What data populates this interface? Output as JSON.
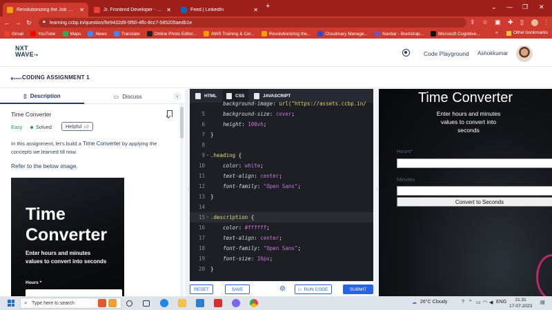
{
  "browser": {
    "tabs": [
      {
        "title": "Revolutionizing the Job Market |",
        "active": true,
        "color": "#f59e0b"
      },
      {
        "title": "Jr. Frontend Developer - HowNo",
        "active": false,
        "color": "#ea4335"
      },
      {
        "title": "Feed | LinkedIn",
        "active": false,
        "color": "#0a66c2"
      }
    ],
    "new_tab": "+",
    "url": "learning.ccbp.in/question/5e9432d9-5f60-4ffc-8cc7-585205aedb1e",
    "bookmarks": [
      {
        "label": "Gmail",
        "color": "#ea4335"
      },
      {
        "label": "YouTube",
        "color": "#ff0000"
      },
      {
        "label": "Maps",
        "color": "#34a853"
      },
      {
        "label": "News",
        "color": "#4285f4"
      },
      {
        "label": "Translate",
        "color": "#4285f4"
      },
      {
        "label": "Online Photo Editor...",
        "color": "#222222"
      },
      {
        "label": "AWS Training & Cer...",
        "color": "#ff9900"
      },
      {
        "label": "Revolutionizing the...",
        "color": "#f59e0b"
      },
      {
        "label": "Cloudinary Manage...",
        "color": "#3448c5"
      },
      {
        "label": "Navbar - Bootstrap...",
        "color": "#7952b3"
      },
      {
        "label": "Microsoft Cognitive...",
        "color": "#111111"
      }
    ],
    "bookmarks_more": "»",
    "other_bookmarks": "Other bookmarks"
  },
  "app": {
    "logo_line1": "NXT",
    "logo_line2": "WAVE",
    "logo_tm": "TM",
    "code_playground": "Code Playground",
    "username": "Ashokkumar",
    "assignment_title": "CODING ASSIGNMENT 1"
  },
  "left": {
    "tab_description": "Description",
    "tab_discuss": "Discuss",
    "problem_title": "Time Converter",
    "difficulty": "Easy",
    "status": "Solved",
    "helpful": "Helpful",
    "desc_before": "In this assignment, let's build a ",
    "desc_highlight": "Time Converter",
    "desc_after": " by applying the concepts we learned till now.",
    "refer": "Refer to the below image.",
    "preview": {
      "title_line1": "Time",
      "title_line2": "Converter",
      "desc": "Enter hours and minutes values to convert into seconds",
      "label": "Hours *"
    }
  },
  "editor": {
    "tabs": [
      {
        "label": "HTML",
        "active": false
      },
      {
        "label": "CSS",
        "active": true
      },
      {
        "label": "JAVASCRIPT",
        "active": false
      }
    ],
    "lines": [
      {
        "n": "",
        "fold": "",
        "prop": "background-image",
        "val": "url(\"https://assets.ccbp.in/",
        "kind": "partial"
      },
      {
        "n": "5",
        "fold": "",
        "prop": "background-size",
        "val": "cover",
        "kind": "decl"
      },
      {
        "n": "6",
        "fold": "",
        "prop": "height",
        "val": "100vh",
        "kind": "decl"
      },
      {
        "n": "7",
        "fold": "",
        "text": "}",
        "kind": "plain"
      },
      {
        "n": "8",
        "fold": "",
        "text": "",
        "kind": "plain"
      },
      {
        "n": "9",
        "fold": "▾",
        "sel": ".heading",
        "kind": "rule"
      },
      {
        "n": "10",
        "fold": "",
        "prop": "color",
        "val": "white",
        "kind": "decl"
      },
      {
        "n": "11",
        "fold": "",
        "prop": "text-align",
        "val": "center",
        "kind": "decl"
      },
      {
        "n": "12",
        "fold": "",
        "prop": "font-family",
        "val": "\"Open Sans\"",
        "kind": "decl"
      },
      {
        "n": "13",
        "fold": "",
        "text": "}",
        "kind": "plain"
      },
      {
        "n": "14",
        "fold": "",
        "text": "",
        "kind": "plain"
      },
      {
        "n": "15",
        "fold": "▾",
        "sel": ".description",
        "kind": "rule",
        "current": true
      },
      {
        "n": "16",
        "fold": "",
        "prop": "color",
        "val": "#ffffff",
        "kind": "decl"
      },
      {
        "n": "17",
        "fold": "",
        "prop": "text-align",
        "val": "center",
        "kind": "decl"
      },
      {
        "n": "18",
        "fold": "",
        "prop": "font-family",
        "val": "\"Open Sans\"",
        "kind": "decl"
      },
      {
        "n": "19",
        "fold": "",
        "prop": "font-size",
        "val": "16px",
        "kind": "decl"
      },
      {
        "n": "20",
        "fold": "",
        "text": "}",
        "kind": "plain"
      }
    ],
    "reset": "RESET",
    "save": "SAVE",
    "run": "RUN CODE",
    "submit": "SUBMIT"
  },
  "output": {
    "title": "Time Converter",
    "desc": "Enter hours and minutes values to convert into seconds",
    "hours_label": "Hours*",
    "minutes_label": "Minutes",
    "button": "Convert to Seconds"
  },
  "taskbar": {
    "search_placeholder": "Type here to search",
    "weather": "26°C  Cloudy",
    "lang": "ENG",
    "time": "21:31",
    "date": "17-07-2023"
  }
}
